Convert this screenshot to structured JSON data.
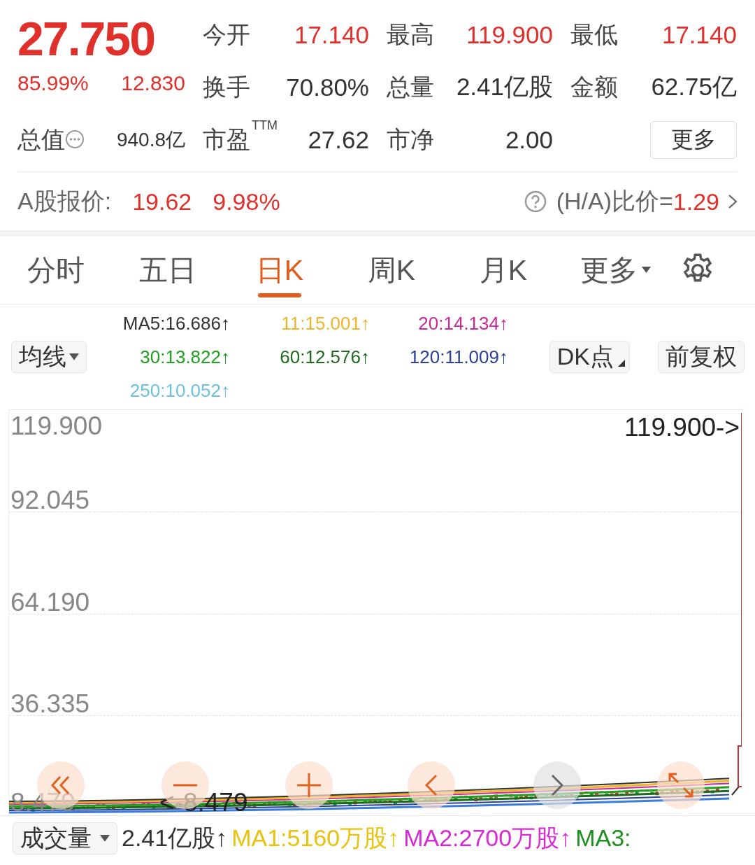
{
  "quote": {
    "price": "27.750",
    "change_pct": "85.99%",
    "change": "12.830"
  },
  "stats": [
    {
      "label": "今开",
      "value": "17.140",
      "kind": "up"
    },
    {
      "label": "最高",
      "value": "119.900",
      "kind": "up"
    },
    {
      "label": "最低",
      "value": "17.140",
      "kind": "up"
    },
    {
      "label": "换手",
      "value": "70.80%",
      "kind": "plain"
    },
    {
      "label": "总量",
      "value": "2.41亿股",
      "kind": "plain"
    },
    {
      "label": "金额",
      "value": "62.75亿",
      "kind": "plain"
    },
    {
      "label": "总值",
      "value": "940.8亿",
      "kind": "info"
    },
    {
      "label": "市盈",
      "sup": "TTM",
      "value": "27.62",
      "kind": "plain"
    },
    {
      "label": "市净",
      "value": "2.00",
      "kind": "plain"
    }
  ],
  "more_button": "更多",
  "a_share": {
    "label": "A股报价:",
    "price": "19.62",
    "change_pct": "9.98%",
    "ratio_label": "(H/A)比价=",
    "ratio_value": "1.29"
  },
  "tabs": [
    {
      "label": "分时",
      "selected": false,
      "kind": "tab"
    },
    {
      "label": "五日",
      "selected": false,
      "kind": "tab"
    },
    {
      "label": "日K",
      "selected": true,
      "kind": "tab"
    },
    {
      "label": "周K",
      "selected": false,
      "kind": "tab"
    },
    {
      "label": "月K",
      "selected": false,
      "kind": "tab"
    },
    {
      "label": "更多",
      "selected": false,
      "kind": "dropdown"
    }
  ],
  "ma_dropdown": "均线",
  "ma_legend": [
    {
      "text": "MA5:16.686↑",
      "color": "#333333"
    },
    {
      "text": "11:15.001↑",
      "color": "#f0b429"
    },
    {
      "text": "20:14.134↑",
      "color": "#c8289a"
    },
    {
      "text": "30:13.822↑",
      "color": "#1fa01f"
    },
    {
      "text": "60:12.576↑",
      "color": "#1e6b1e"
    },
    {
      "text": "120:11.009↑",
      "color": "#2a3f9a"
    },
    {
      "text": "250:10.052↑",
      "color": "#6cc0e0"
    }
  ],
  "dk_button": "DK点",
  "adjust_button": "前复权",
  "chart": {
    "y_labels": [
      "119.900",
      "92.045",
      "64.190",
      "36.335",
      "8.479"
    ],
    "high_marker": "119.900->",
    "low_marker": "<-8.479"
  },
  "chart_controls": [
    {
      "kind": "first",
      "disabled": false
    },
    {
      "kind": "zoom_out",
      "disabled": false
    },
    {
      "kind": "zoom_in",
      "disabled": false
    },
    {
      "kind": "prev",
      "disabled": false
    },
    {
      "kind": "next",
      "disabled": true
    },
    {
      "kind": "reset",
      "disabled": false
    }
  ],
  "volume": {
    "dropdown": "成交量",
    "items": [
      {
        "text": "2.41亿股↑",
        "color": "#333333"
      },
      {
        "text": "MA1:5160万股↑",
        "color": "#e8c20c"
      },
      {
        "text": "MA2:2700万股↑",
        "color": "#d62ad6"
      },
      {
        "text": "MA3:",
        "color": "#1e8f1e"
      }
    ]
  }
}
